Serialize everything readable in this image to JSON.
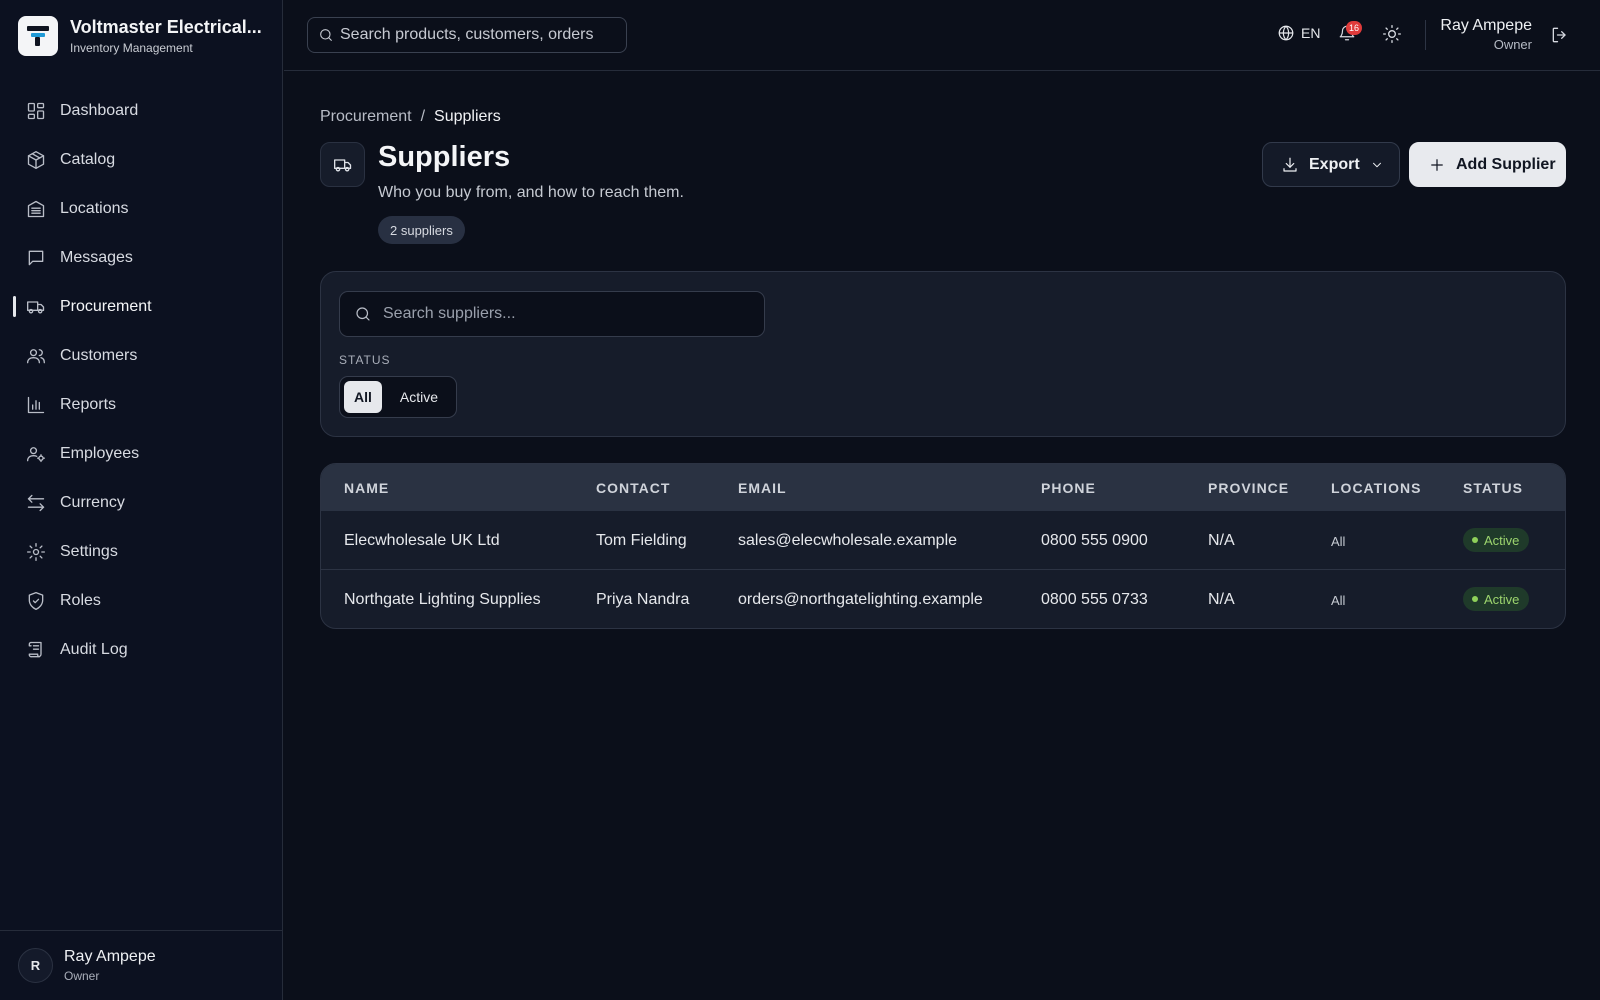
{
  "brand": {
    "name": "Voltmaster Electrical...",
    "subtitle": "Inventory Management"
  },
  "sidebar": {
    "items": [
      {
        "label": "Dashboard",
        "icon": "dashboard-icon"
      },
      {
        "label": "Catalog",
        "icon": "box-icon"
      },
      {
        "label": "Locations",
        "icon": "building-icon"
      },
      {
        "label": "Messages",
        "icon": "message-icon"
      },
      {
        "label": "Procurement",
        "icon": "truck-icon",
        "active": true
      },
      {
        "label": "Customers",
        "icon": "users-icon"
      },
      {
        "label": "Reports",
        "icon": "chart-icon"
      },
      {
        "label": "Employees",
        "icon": "user-cog-icon"
      },
      {
        "label": "Currency",
        "icon": "arrows-icon"
      },
      {
        "label": "Settings",
        "icon": "gear-icon"
      },
      {
        "label": "Roles",
        "icon": "shield-icon"
      },
      {
        "label": "Audit Log",
        "icon": "scroll-icon"
      }
    ],
    "footer": {
      "avatar_initial": "R",
      "name": "Ray Ampepe",
      "role": "Owner"
    }
  },
  "topbar": {
    "search_placeholder": "Search products, customers, orders",
    "language": "EN",
    "notification_count": "16",
    "user_name": "Ray Ampepe",
    "user_role": "Owner"
  },
  "breadcrumb": {
    "parent": "Procurement",
    "separator": "/",
    "current": "Suppliers"
  },
  "page": {
    "title": "Suppliers",
    "subtitle": "Who you buy from, and how to reach them.",
    "count_chip": "2 suppliers",
    "export_label": "Export",
    "add_label": "Add Supplier"
  },
  "filters": {
    "search_placeholder": "Search suppliers...",
    "status_label": "STATUS",
    "status_options": [
      "All",
      "Active"
    ],
    "selected_status": "All"
  },
  "table": {
    "columns": [
      "NAME",
      "CONTACT",
      "EMAIL",
      "PHONE",
      "PROVINCE",
      "LOCATIONS",
      "STATUS"
    ],
    "rows": [
      {
        "name": "Elecwholesale UK Ltd",
        "contact": "Tom Fielding",
        "email": "sales@elecwholesale.example",
        "phone": "0800 555 0900",
        "province": "N/A",
        "locations": "All",
        "status": "Active"
      },
      {
        "name": "Northgate Lighting Supplies",
        "contact": "Priya Nandra",
        "email": "orders@northgatelighting.example",
        "phone": "0800 555 0733",
        "province": "N/A",
        "locations": "All",
        "status": "Active"
      }
    ]
  },
  "colors": {
    "background": "#0b0f1a",
    "card": "#161c2a",
    "accent_light": "#e8eaee",
    "status_active_text": "#9cd56e",
    "status_active_bg": "#1f3a2a",
    "notification_badge": "#e03b3b"
  }
}
